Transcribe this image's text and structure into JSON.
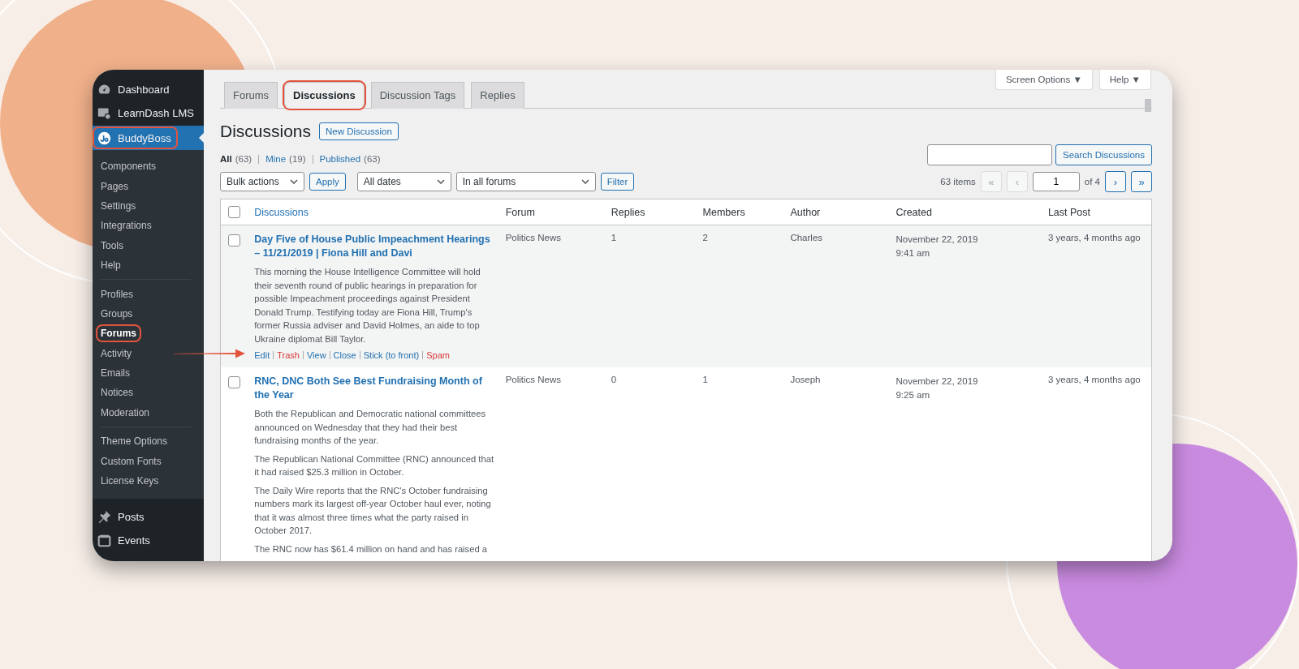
{
  "sidebar": {
    "top_items": [
      {
        "label": "Dashboard",
        "kind": "dashboard"
      },
      {
        "label": "LearnDash LMS",
        "kind": "lms"
      }
    ],
    "current": {
      "label": "BuddyBoss",
      "kind": "buddyboss",
      "highlighted": true
    },
    "submenu_groups": [
      [
        {
          "label": "Components",
          "selected": false,
          "highlighted": false
        },
        {
          "label": "Pages",
          "selected": false,
          "highlighted": false
        },
        {
          "label": "Settings",
          "selected": false,
          "highlighted": false
        },
        {
          "label": "Integrations",
          "selected": false,
          "highlighted": false
        },
        {
          "label": "Tools",
          "selected": false,
          "highlighted": false
        },
        {
          "label": "Help",
          "selected": false,
          "highlighted": false
        }
      ],
      [
        {
          "label": "Profiles",
          "selected": false,
          "highlighted": false
        },
        {
          "label": "Groups",
          "selected": false,
          "highlighted": false
        },
        {
          "label": "Forums",
          "selected": true,
          "highlighted": true
        },
        {
          "label": "Activity",
          "selected": false,
          "highlighted": false
        },
        {
          "label": "Emails",
          "selected": false,
          "highlighted": false
        },
        {
          "label": "Notices",
          "selected": false,
          "highlighted": false
        },
        {
          "label": "Moderation",
          "selected": false,
          "highlighted": false
        }
      ],
      [
        {
          "label": "Theme Options",
          "selected": false,
          "highlighted": false
        },
        {
          "label": "Custom Fonts",
          "selected": false,
          "highlighted": false
        },
        {
          "label": "License Keys",
          "selected": false,
          "highlighted": false
        }
      ]
    ],
    "bottom_items": [
      {
        "label": "Posts",
        "kind": "pin"
      },
      {
        "label": "Events",
        "kind": "events"
      }
    ]
  },
  "screen_meta": [
    "Screen Options ▼",
    "Help ▼"
  ],
  "tabs": [
    {
      "label": "Forums",
      "selected": false,
      "highlighted": false
    },
    {
      "label": "Discussions",
      "selected": true,
      "highlighted": true
    },
    {
      "label": "Discussion Tags",
      "selected": false,
      "highlighted": false
    },
    {
      "label": "Replies",
      "selected": false,
      "highlighted": false
    }
  ],
  "page_title": "Discussions",
  "add_new": "New Discussion",
  "views": [
    {
      "label": "All",
      "count": "(63)",
      "selected": true
    },
    {
      "label": "Mine",
      "count": "(19)",
      "selected": false
    },
    {
      "label": "Published",
      "count": "(63)",
      "selected": false
    }
  ],
  "search": {
    "button": "Search Discussions"
  },
  "filters": {
    "bulk": "Bulk actions",
    "apply": "Apply",
    "dates": "All dates",
    "forums": "In all forums",
    "filter": "Filter"
  },
  "pagination": {
    "items": "63 items",
    "first": "«",
    "prev": "‹",
    "page": "1",
    "of": "of 4",
    "next": "›",
    "last": "»"
  },
  "table": {
    "select_all_checked": false,
    "columns": [
      "Discussions",
      "Forum",
      "Replies",
      "Members",
      "Author",
      "Created",
      "Last Post"
    ],
    "rows": [
      {
        "title": "Day Five of House Public Impeachment Hearings – 11/21/2019 | Fiona Hill and Davi",
        "paragraphs": [
          "This morning the House Intelligence Committee will hold their seventh round of public hearings in preparation for possible Impeachment proceedings against President Donald Trump. Testifying today are Fiona Hill, Trump's former Russia adviser and David Holmes, an aide to top Ukraine diplomat Bill Taylor."
        ],
        "actions": [
          {
            "label": "Edit",
            "kind": "link"
          },
          {
            "label": "Trash",
            "kind": "danger"
          },
          {
            "label": "View",
            "kind": "link"
          },
          {
            "label": "Close",
            "kind": "link"
          },
          {
            "label": "Stick (to front)",
            "kind": "link"
          },
          {
            "label": "Spam",
            "kind": "danger"
          }
        ],
        "forum": "Politics News",
        "replies": "1",
        "members": "2",
        "author": "Charles",
        "created": "November 22, 2019",
        "created_time": "9:41 am",
        "last_post": "3 years, 4 months ago",
        "checked": false,
        "hovered": true,
        "pointed": true
      },
      {
        "title": "RNC, DNC Both See Best Fundraising Month of the Year",
        "paragraphs": [
          "Both the Republican and Democratic national committees announced on Wednesday that they had their best fundraising months of the year.",
          "The Republican National Committee (RNC) announced that it had raised $25.3 million in October.",
          "The Daily Wire reports that the RNC's October fundraising numbers mark its largest off-year October haul ever, noting that it was almost three times what the party raised in October 2017.",
          "The RNC now has $61.4 million on hand and has raised a"
        ],
        "actions": [],
        "forum": "Politics News",
        "replies": "0",
        "members": "1",
        "author": "Joseph",
        "created": "November 22, 2019",
        "created_time": "9:25 am",
        "last_post": "3 years, 4 months ago",
        "checked": false,
        "hovered": false,
        "pointed": false
      }
    ]
  }
}
